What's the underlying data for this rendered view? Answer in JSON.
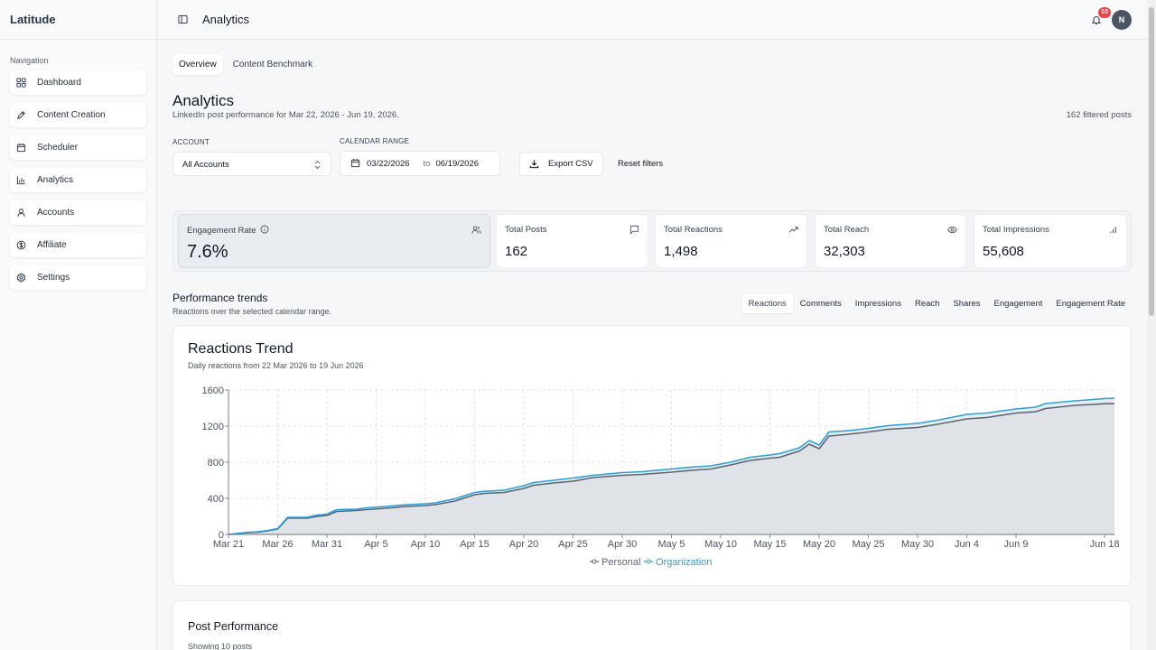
{
  "app": {
    "brand": "Latitude",
    "page_heading": "Analytics"
  },
  "sidebar": {
    "heading": "Navigation",
    "items": [
      {
        "label": "Dashboard",
        "icon": "grid-icon"
      },
      {
        "label": "Content Creation",
        "icon": "pen-icon"
      },
      {
        "label": "Scheduler",
        "icon": "calendar-icon"
      },
      {
        "label": "Analytics",
        "icon": "bar-chart-icon"
      },
      {
        "label": "Accounts",
        "icon": "user-icon"
      },
      {
        "label": "Affiliate",
        "icon": "dollar-icon"
      },
      {
        "label": "Settings",
        "icon": "gear-icon"
      }
    ]
  },
  "header": {
    "notifications": "10",
    "avatar_initial": "N"
  },
  "tabs": [
    "Overview",
    "Content Benchmark"
  ],
  "page": {
    "title": "Analytics",
    "subtitle": "LinkedIn post performance for Mar 22, 2026 - Jun 19, 2026.",
    "filtered": "162 filtered posts"
  },
  "filters": {
    "account_label": "ACCOUNT",
    "account_value": "All Accounts",
    "range_label": "CALENDAR RANGE",
    "from": "03/22/2026",
    "to_label": "to",
    "to": "06/19/2026",
    "export": "Export CSV",
    "reset": "Reset filters"
  },
  "kpis": [
    {
      "label": "Engagement Rate",
      "value": "7.6%",
      "icon": "users-icon"
    },
    {
      "label": "Total Posts",
      "value": "162",
      "icon": "message-icon"
    },
    {
      "label": "Total Reactions",
      "value": "1,498",
      "icon": "trending-up-icon"
    },
    {
      "label": "Total Reach",
      "value": "32,303",
      "icon": "eye-icon"
    },
    {
      "label": "Total Impressions",
      "value": "55,608",
      "icon": "bar-chart-icon"
    }
  ],
  "trends": {
    "title": "Performance trends",
    "subtitle": "Reactions over the selected calendar range.",
    "metric_tabs": [
      "Reactions",
      "Comments",
      "Impressions",
      "Reach",
      "Shares",
      "Engagement",
      "Engagement Rate"
    ]
  },
  "chart_card": {
    "title": "Reactions Trend",
    "subtitle": "Daily reactions from 22 Mar 2026 to 19 Jun 2026"
  },
  "chart_data": {
    "type": "area",
    "x_ticks": [
      "Mar 21",
      "Mar 26",
      "Mar 31",
      "Apr 5",
      "Apr 10",
      "Apr 15",
      "Apr 20",
      "Apr 25",
      "Apr 30",
      "May 5",
      "May 10",
      "May 15",
      "May 20",
      "May 25",
      "May 30",
      "Jun 4",
      "Jun 9",
      "Jun 18"
    ],
    "y_ticks": [
      0,
      400,
      800,
      1200,
      1600
    ],
    "ylim": [
      0,
      1600
    ],
    "grid": true,
    "legend_position": "bottom",
    "series": [
      {
        "name": "Personal",
        "color": "#5b6573",
        "points": [
          [
            "Mar 21",
            0
          ],
          [
            "Mar 23",
            20
          ],
          [
            "Mar 24",
            25
          ],
          [
            "Mar 25",
            40
          ],
          [
            "Mar 26",
            60
          ],
          [
            "Mar 27",
            180
          ],
          [
            "Mar 29",
            180
          ],
          [
            "Mar 30",
            200
          ],
          [
            "Mar 31",
            210
          ],
          [
            "Apr 1",
            255
          ],
          [
            "Apr 3",
            265
          ],
          [
            "Apr 4",
            275
          ],
          [
            "Apr 6",
            290
          ],
          [
            "Apr 8",
            310
          ],
          [
            "Apr 10",
            320
          ],
          [
            "Apr 11",
            330
          ],
          [
            "Apr 13",
            370
          ],
          [
            "Apr 15",
            440
          ],
          [
            "Apr 16",
            455
          ],
          [
            "Apr 18",
            465
          ],
          [
            "Apr 20",
            510
          ],
          [
            "Apr 21",
            545
          ],
          [
            "Apr 23",
            570
          ],
          [
            "Apr 25",
            590
          ],
          [
            "Apr 27",
            630
          ],
          [
            "Apr 30",
            655
          ],
          [
            "May 2",
            665
          ],
          [
            "May 5",
            690
          ],
          [
            "May 7",
            710
          ],
          [
            "May 9",
            725
          ],
          [
            "May 11",
            770
          ],
          [
            "May 13",
            820
          ],
          [
            "May 15",
            845
          ],
          [
            "May 16",
            855
          ],
          [
            "May 18",
            925
          ],
          [
            "May 19",
            1000
          ],
          [
            "May 20",
            950
          ],
          [
            "May 21",
            1090
          ],
          [
            "May 23",
            1110
          ],
          [
            "May 25",
            1135
          ],
          [
            "May 27",
            1165
          ],
          [
            "May 30",
            1185
          ],
          [
            "Jun 1",
            1220
          ],
          [
            "Jun 4",
            1280
          ],
          [
            "Jun 6",
            1295
          ],
          [
            "Jun 9",
            1345
          ],
          [
            "Jun 11",
            1360
          ],
          [
            "Jun 12",
            1395
          ],
          [
            "Jun 15",
            1430
          ],
          [
            "Jun 18",
            1448
          ],
          [
            "Jun 19",
            1450
          ]
        ]
      },
      {
        "name": "Organization",
        "color": "#2aa0dc",
        "points": [
          [
            "Mar 21",
            0
          ],
          [
            "Mar 23",
            25
          ],
          [
            "Mar 24",
            30
          ],
          [
            "Mar 25",
            45
          ],
          [
            "Mar 26",
            65
          ],
          [
            "Mar 27",
            190
          ],
          [
            "Mar 29",
            190
          ],
          [
            "Mar 30",
            215
          ],
          [
            "Mar 31",
            225
          ],
          [
            "Apr 1",
            275
          ],
          [
            "Apr 3",
            280
          ],
          [
            "Apr 4",
            295
          ],
          [
            "Apr 6",
            310
          ],
          [
            "Apr 8",
            330
          ],
          [
            "Apr 10",
            340
          ],
          [
            "Apr 11",
            350
          ],
          [
            "Apr 13",
            395
          ],
          [
            "Apr 15",
            465
          ],
          [
            "Apr 16",
            478
          ],
          [
            "Apr 18",
            490
          ],
          [
            "Apr 20",
            540
          ],
          [
            "Apr 21",
            575
          ],
          [
            "Apr 23",
            600
          ],
          [
            "Apr 25",
            625
          ],
          [
            "Apr 27",
            655
          ],
          [
            "Apr 30",
            685
          ],
          [
            "May 2",
            695
          ],
          [
            "May 5",
            725
          ],
          [
            "May 7",
            745
          ],
          [
            "May 9",
            760
          ],
          [
            "May 11",
            800
          ],
          [
            "May 13",
            855
          ],
          [
            "May 15",
            880
          ],
          [
            "May 16",
            895
          ],
          [
            "May 18",
            960
          ],
          [
            "May 19",
            1040
          ],
          [
            "May 20",
            990
          ],
          [
            "May 21",
            1135
          ],
          [
            "May 23",
            1150
          ],
          [
            "May 25",
            1175
          ],
          [
            "May 27",
            1205
          ],
          [
            "May 30",
            1230
          ],
          [
            "Jun 1",
            1265
          ],
          [
            "Jun 4",
            1330
          ],
          [
            "Jun 6",
            1345
          ],
          [
            "Jun 9",
            1390
          ],
          [
            "Jun 11",
            1410
          ],
          [
            "Jun 12",
            1450
          ],
          [
            "Jun 15",
            1480
          ],
          [
            "Jun 18",
            1505
          ],
          [
            "Jun 19",
            1508
          ]
        ]
      }
    ]
  },
  "post_perf": {
    "title": "Post Performance",
    "subtitle": "Showing 10 posts"
  }
}
